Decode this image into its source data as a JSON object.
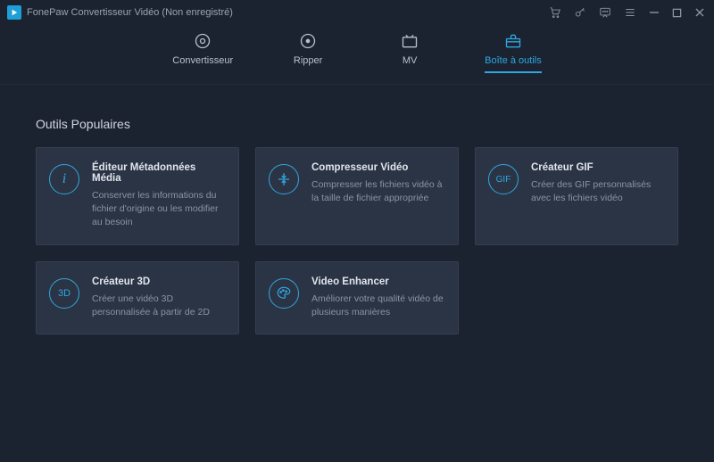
{
  "app": {
    "title": "FonePaw Convertisseur Vidéo (Non enregistré)"
  },
  "tabs": {
    "converter": "Convertisseur",
    "ripper": "Ripper",
    "mv": "MV",
    "toolbox": "Boîte à outils"
  },
  "section": {
    "popular_tools": "Outils Populaires"
  },
  "tools": {
    "metadata": {
      "title": "Éditeur Métadonnées Média",
      "desc": "Conserver les informations du fichier d'origine ou les modifier au besoin",
      "icon_label": "i"
    },
    "compressor": {
      "title": "Compresseur Vidéo",
      "desc": "Compresser les fichiers vidéo à la taille de fichier appropriée"
    },
    "gif": {
      "title": "Créateur GIF",
      "desc": "Créer des GIF personnalisés avec les fichiers vidéo",
      "icon_label": "GIF"
    },
    "3d": {
      "title": "Créateur 3D",
      "desc": "Créer une vidéo 3D personnalisée à partir de 2D",
      "icon_label": "3D"
    },
    "enhancer": {
      "title": "Video Enhancer",
      "desc": "Améliorer votre qualité vidéo de plusieurs manières"
    }
  },
  "colors": {
    "accent": "#2fa7e0",
    "bg": "#1b2331",
    "card": "#2b3444"
  }
}
